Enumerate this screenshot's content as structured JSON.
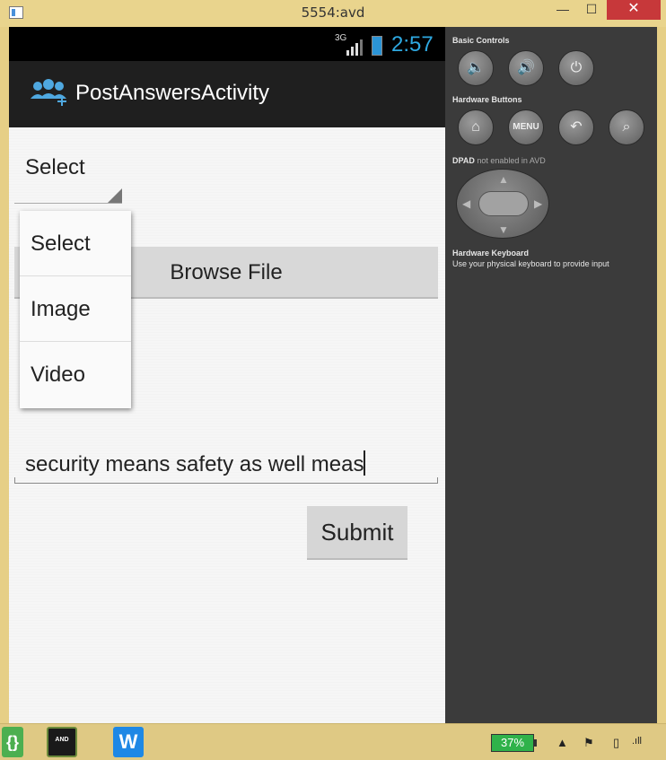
{
  "window": {
    "title": "5554:avd",
    "min": "—",
    "max": "☐",
    "close": "✕"
  },
  "statusbar": {
    "network": "3G",
    "time": "2:57"
  },
  "actionbar": {
    "title": "PostAnswersActivity"
  },
  "form": {
    "spinner_value": "Select",
    "browse_label": "Browse File",
    "answer_value": "security means safety as well meas",
    "submit_label": "Submit"
  },
  "dropdown": {
    "options": [
      "Select",
      "Image",
      "Video"
    ]
  },
  "controls": {
    "basic_title": "Basic Controls",
    "hardware_title": "Hardware Buttons",
    "menu_label": "MENU",
    "dpad_title": "DPAD",
    "dpad_note": "not enabled in AVD",
    "keyboard_title": "Hardware Keyboard",
    "keyboard_note": "Use your physical keyboard to provide input"
  },
  "taskbar": {
    "app2_label": "AND",
    "battery": "37%"
  }
}
